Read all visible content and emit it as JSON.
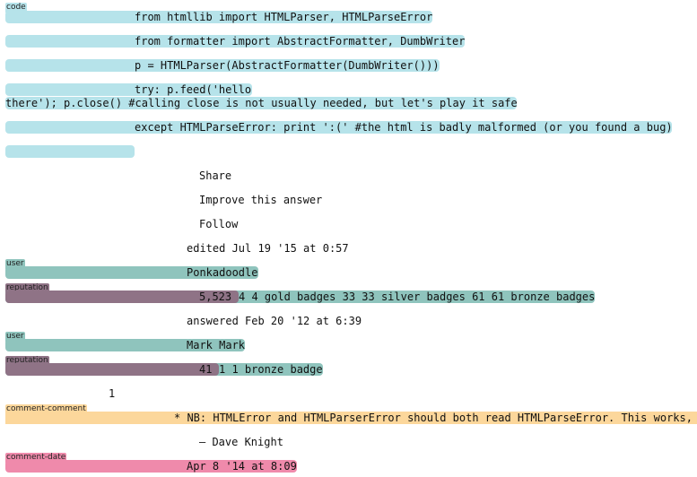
{
  "labels": {
    "code": "code",
    "user": "user",
    "reputation": "reputation",
    "comment_comment": "comment-comment",
    "comment_date": "comment-date"
  },
  "code_lines": [
    "from htmllib import HTMLParser, HTMLParseError",
    "from formatter import AbstractFormatter, DumbWriter",
    "p = HTMLParser(AbstractFormatter(DumbWriter()))",
    "try: p.feed('hello",
    "there'); p.close() #calling close is not usually needed, but let's play it safe",
    "except HTMLParseError: print ':(' #the html is badly malformed (or you found a bug)"
  ],
  "actions": {
    "share": "Share",
    "improve": "Improve this answer",
    "follow": "Follow"
  },
  "editor": {
    "edited": "edited Jul 19 '15 at 0:57",
    "name": "Ponkadoodle",
    "reputation": "5,523",
    "badges": "4 4 gold badges 33 33 silver badges 61 61 bronze badges"
  },
  "answerer": {
    "answered": "answered Feb 20 '12 at 6:39",
    "name": "Mark Mark",
    "reputation": "41",
    "badges": "1 1 bronze badge"
  },
  "comment": {
    "score": "1",
    "text": "* NB: HTMLError and HTMLParserError should both read HTMLParseError. This works,",
    "author": "– Dave Knight",
    "date": "Apr 8 '14 at 8:09"
  }
}
